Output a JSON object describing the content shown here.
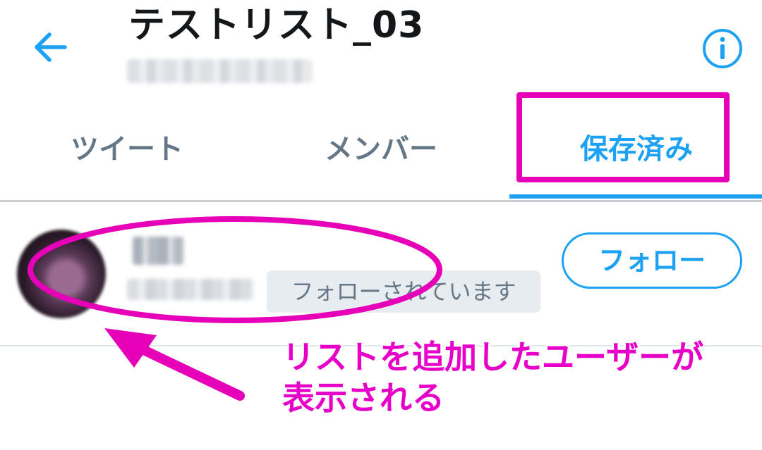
{
  "header": {
    "title": "テストリスト_03",
    "back_icon": "arrow-left-icon",
    "info_icon": "info-circle-icon"
  },
  "tabs": [
    {
      "label": "ツイート",
      "selected": false
    },
    {
      "label": "メンバー",
      "selected": false
    },
    {
      "label": "保存済み",
      "selected": true
    }
  ],
  "list_row": {
    "follows_you_label": "フォローされています",
    "follow_button_label": "フォロー"
  },
  "annotation": {
    "line1": "リストを追加したユーザーが",
    "line2": "表示される"
  },
  "colors": {
    "accent": "#1da1f2",
    "annotation": "#e600b8",
    "text_primary": "#14171a",
    "text_secondary": "#657786"
  }
}
